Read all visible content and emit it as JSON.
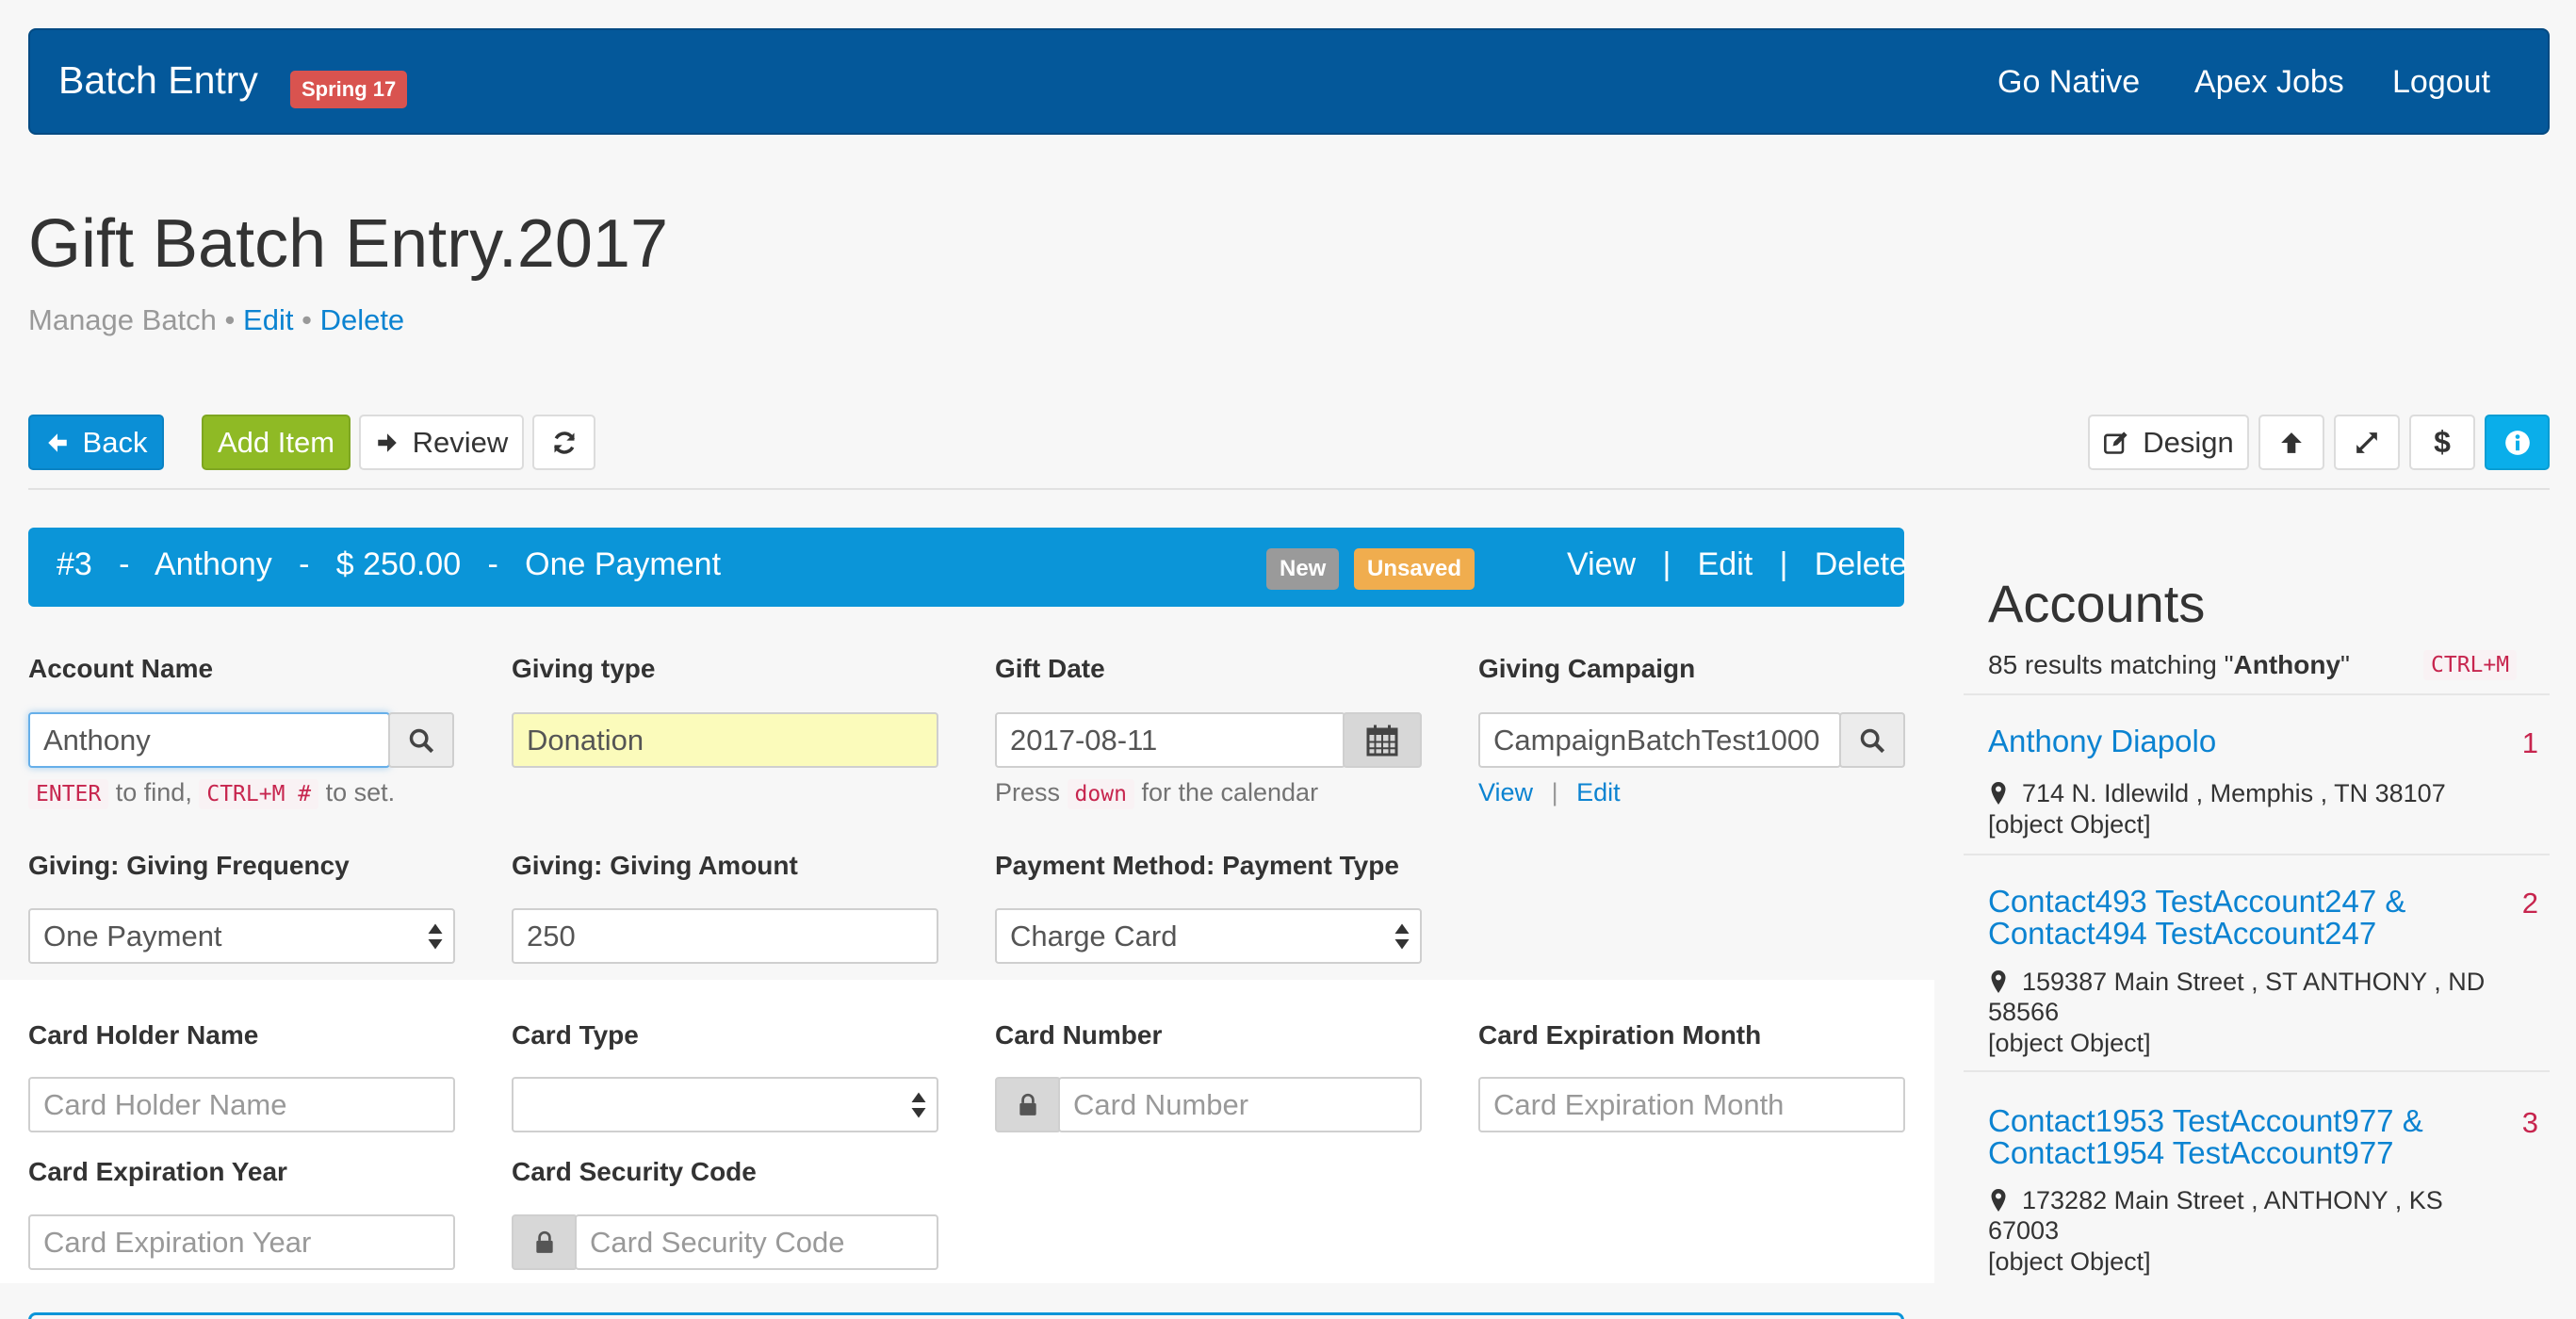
{
  "navbar": {
    "brand": "Batch Entry",
    "release_badge": "Spring 17",
    "links": [
      "Go Native",
      "Apex Jobs",
      "Logout"
    ]
  },
  "header": {
    "title": "Gift Batch Entry.2017",
    "manage_label": "Manage Batch",
    "separator": "•",
    "edit_link": "Edit",
    "delete_link": "Delete"
  },
  "toolbar": {
    "back": "Back",
    "add_item": "Add Item",
    "review": "Review",
    "design": "Design"
  },
  "item": {
    "number": "#3",
    "name": "Anthony",
    "amount": "$ 250.00",
    "frequency": "One Payment",
    "dash": "-",
    "badge_new": "New",
    "badge_unsaved": "Unsaved",
    "actions": [
      "View",
      "Edit",
      "Delete"
    ],
    "action_sep": "|"
  },
  "form": {
    "account_name": {
      "label": "Account Name",
      "value": "Anthony",
      "help_enter": "ENTER",
      "help_to_find": "to find,",
      "help_ctrl": "CTRL+M #",
      "help_to_set": "to set."
    },
    "giving_type": {
      "label": "Giving type",
      "value": "Donation"
    },
    "gift_date": {
      "label": "Gift Date",
      "value": "2017-08-11",
      "help_press": "Press",
      "help_key": "down",
      "help_rest": "for the calendar"
    },
    "giving_campaign": {
      "label": "Giving Campaign",
      "value": "CampaignBatchTest1000",
      "view": "View",
      "sep": "|",
      "edit": "Edit"
    },
    "giving_frequency": {
      "label": "Giving: Giving Frequency",
      "value": "One Payment"
    },
    "giving_amount": {
      "label": "Giving: Giving Amount",
      "value": "250"
    },
    "payment_type": {
      "label": "Payment Method: Payment Type",
      "value": "Charge Card"
    },
    "card_holder": {
      "label": "Card Holder Name",
      "placeholder": "Card Holder Name"
    },
    "card_type": {
      "label": "Card Type",
      "value": ""
    },
    "card_number": {
      "label": "Card Number",
      "placeholder": "Card Number"
    },
    "card_exp_month": {
      "label": "Card Expiration Month",
      "placeholder": "Card Expiration Month"
    },
    "card_exp_year": {
      "label": "Card Expiration Year",
      "placeholder": "Card Expiration Year"
    },
    "card_security": {
      "label": "Card Security Code",
      "placeholder": "Card Security Code"
    }
  },
  "accounts": {
    "title": "Accounts",
    "results_prefix": "85 results matching \"",
    "results_query": "Anthony",
    "results_suffix": "\"",
    "shortcut": "CTRL+M",
    "items": [
      {
        "name": "Anthony Diapolo",
        "number": "1",
        "address": "714 N. Idlewild , Memphis , TN 38107",
        "extra": "[object Object]"
      },
      {
        "name": "Contact493 TestAccount247 & Contact494 TestAccount247",
        "number": "2",
        "address": "159387 Main Street , ST ANTHONY , ND 58566",
        "extra": "[object Object]"
      },
      {
        "name": "Contact1953 TestAccount977 & Contact1954 TestAccount977",
        "number": "3",
        "address": "173282 Main Street , ANTHONY , KS 67003",
        "extra": "[object Object]"
      }
    ]
  },
  "colors": {
    "navbar": "#04589a",
    "primary": "#0b8fd6",
    "success": "#8fba25",
    "info": "#0aaeea",
    "danger": "#d9534f",
    "warning": "#f0ad4e",
    "muted_badge": "#999999",
    "code": "#c7254e"
  }
}
